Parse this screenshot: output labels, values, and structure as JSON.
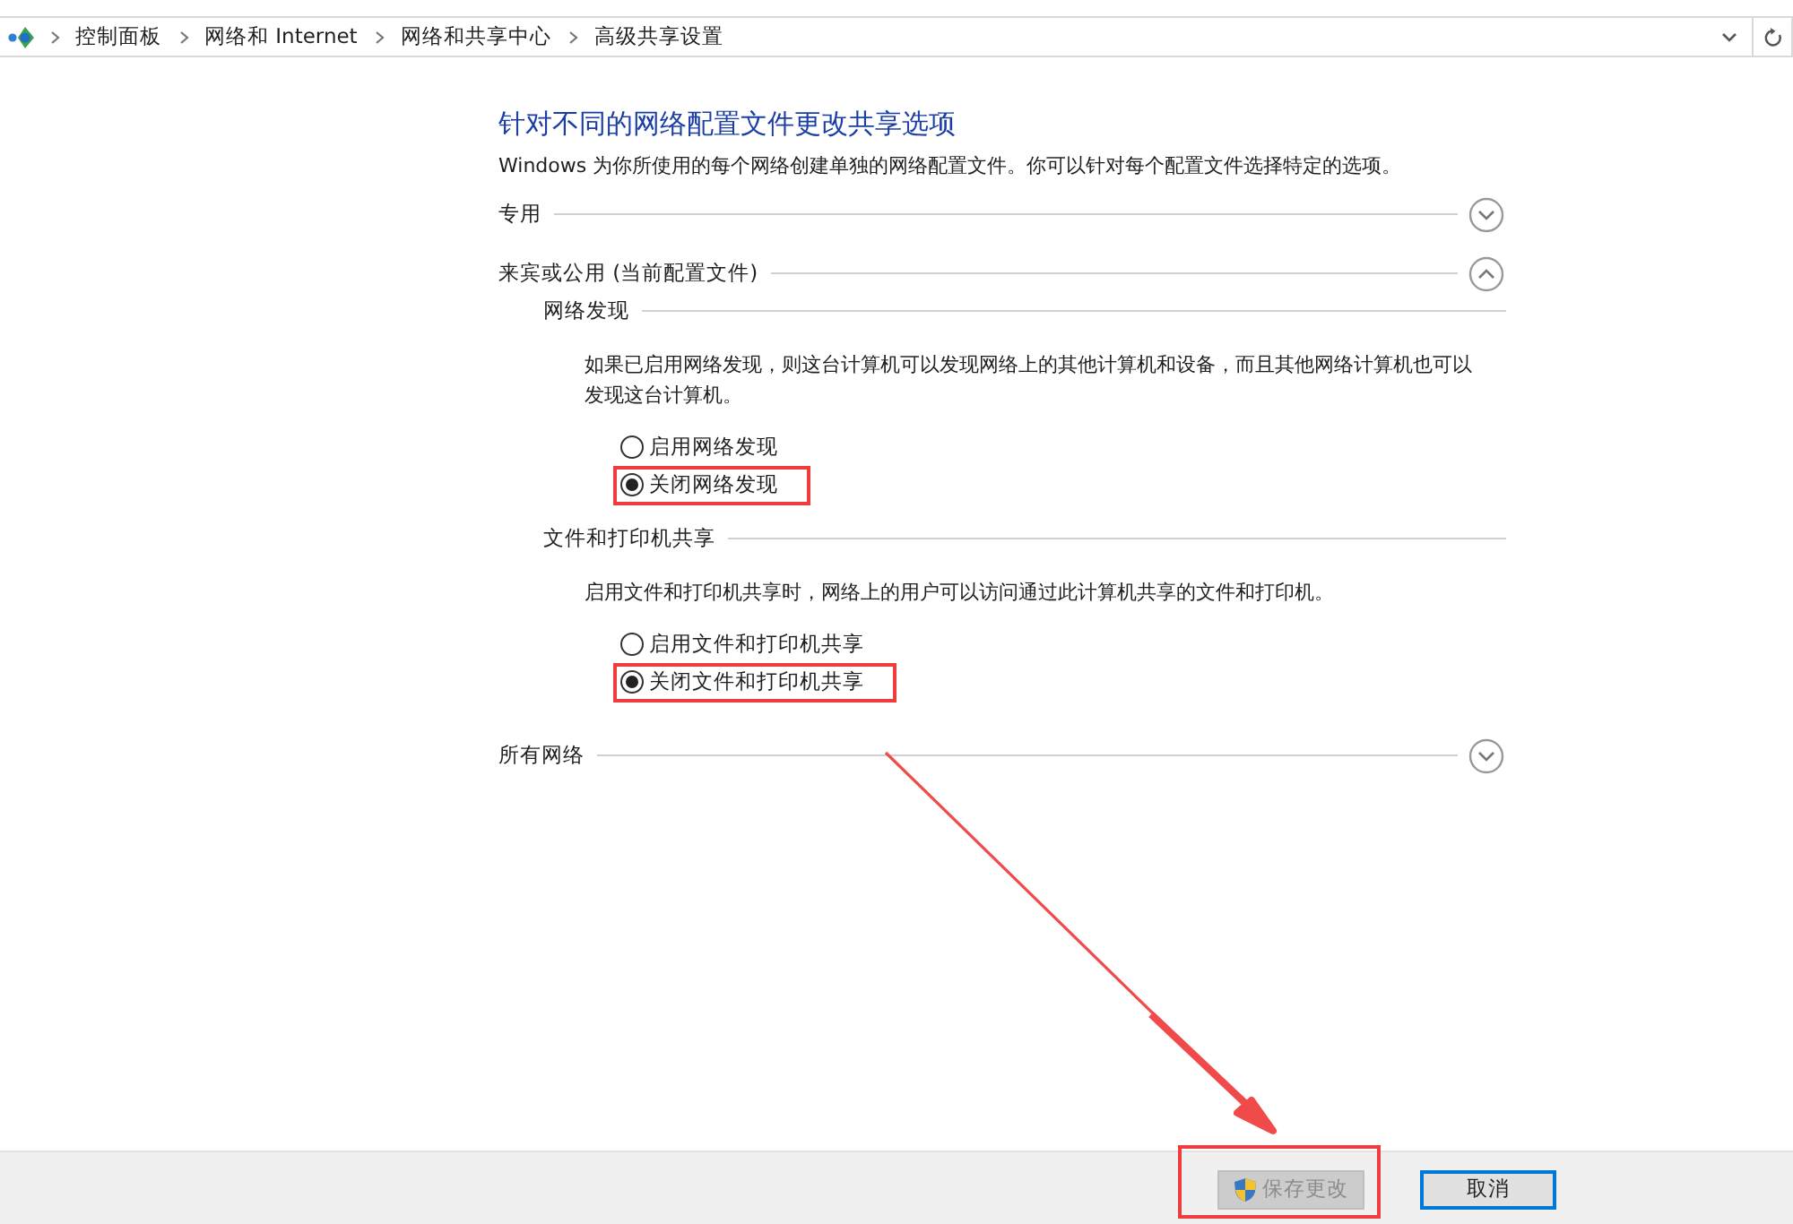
{
  "breadcrumb": [
    "控制面板",
    "网络和 Internet",
    "网络和共享中心",
    "高级共享设置"
  ],
  "title": "针对不同的网络配置文件更改共享选项",
  "subtitle": "Windows 为你所使用的每个网络创建单独的网络配置文件。你可以针对每个配置文件选择特定的选项。",
  "sections": [
    {
      "title": "专用",
      "expanded": false
    },
    {
      "title": "来宾或公用 (当前配置文件)",
      "expanded": true,
      "groups": [
        {
          "title": "网络发现",
          "description": "如果已启用网络发现，则这台计算机可以发现网络上的其他计算机和设备，而且其他网络计算机也可以发现这台计算机。",
          "options": [
            {
              "label": "启用网络发现",
              "selected": false,
              "highlighted": false
            },
            {
              "label": "关闭网络发现",
              "selected": true,
              "highlighted": true
            }
          ]
        },
        {
          "title": "文件和打印机共享",
          "description": "启用文件和打印机共享时，网络上的用户可以访问通过此计算机共享的文件和打印机。",
          "options": [
            {
              "label": "启用文件和打印机共享",
              "selected": false,
              "highlighted": false
            },
            {
              "label": "关闭文件和打印机共享",
              "selected": true,
              "highlighted": true
            }
          ]
        }
      ]
    },
    {
      "title": "所有网络",
      "expanded": false
    }
  ],
  "buttons": [
    {
      "kind": "save",
      "label": "保存更改",
      "disabled": true,
      "highlighted": true
    },
    {
      "kind": "cancel",
      "label": "取消",
      "disabled": false,
      "highlighted": false
    }
  ],
  "pointer_arrow": true
}
